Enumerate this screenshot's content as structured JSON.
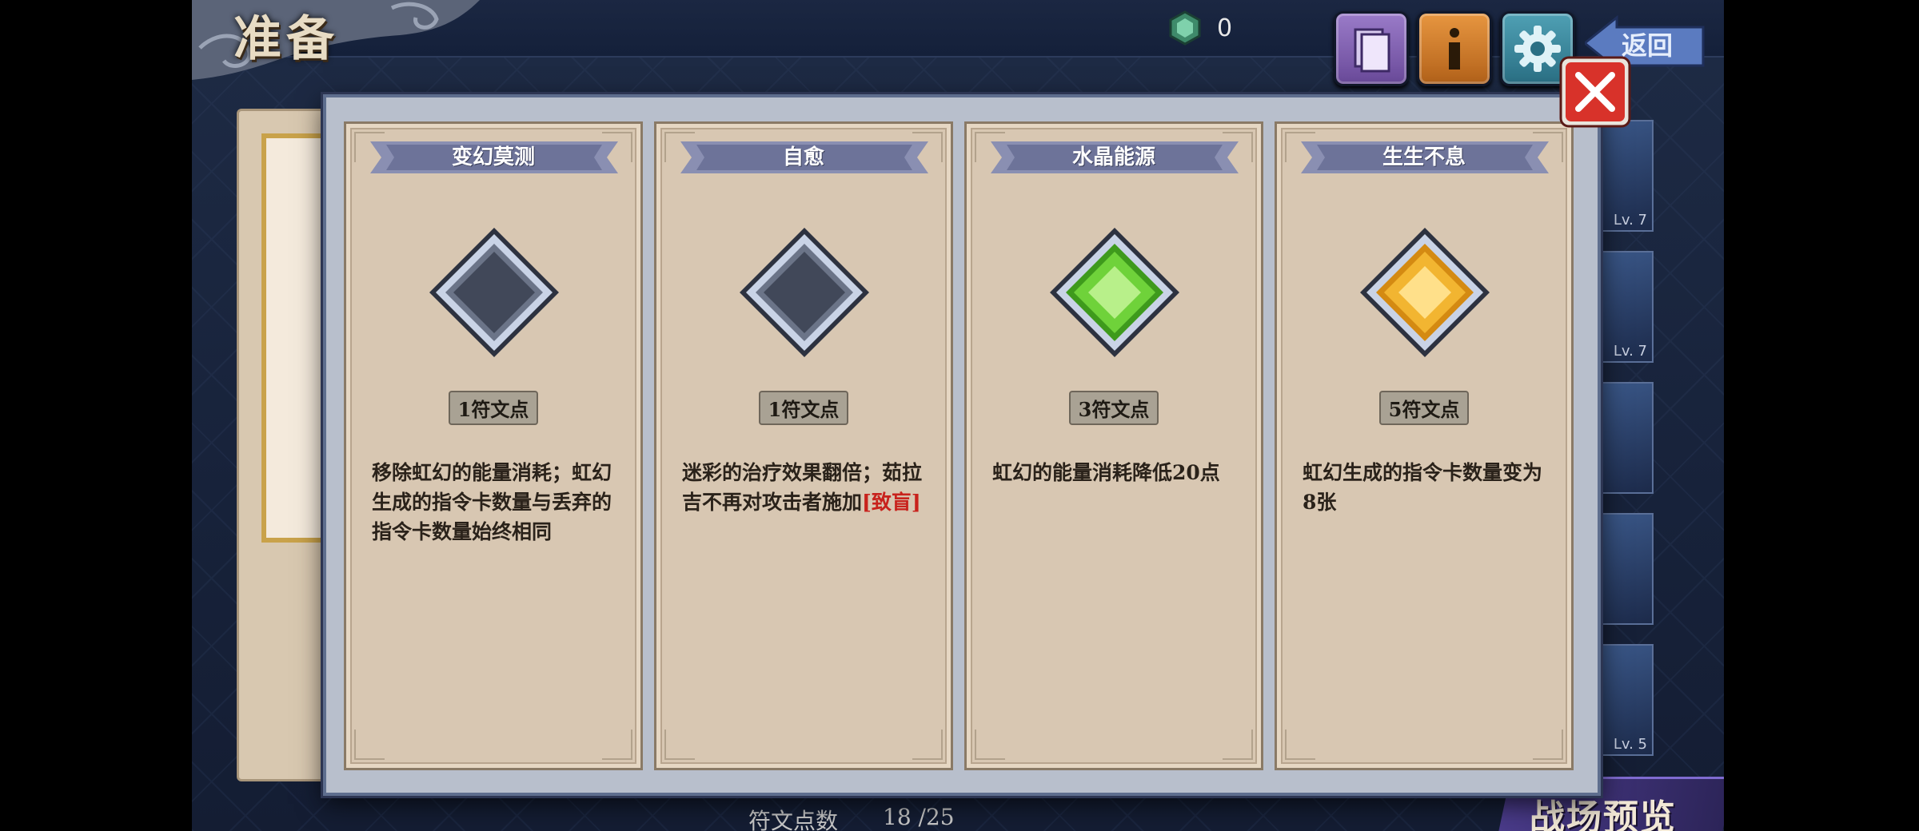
{
  "header": {
    "title": "准备",
    "currency_value": "0",
    "back_label": "返回"
  },
  "side_cards": [
    {
      "level": "Lv. 7"
    },
    {
      "level": "Lv. 7"
    },
    {
      "level": ""
    },
    {
      "level": ""
    },
    {
      "level": "Lv. 5"
    }
  ],
  "footer": {
    "rune_points_label": "符文点数",
    "rune_points_value": "18 /25",
    "battle_preview_label": "战场预览"
  },
  "modal": {
    "cards": [
      {
        "name": "变幻莫测",
        "gem": "empty",
        "cost": "1符文点",
        "desc": "移除虹幻的能量消耗；虹幻生成的指令卡数量与丢弃的指令卡数量始终相同",
        "keyword": ""
      },
      {
        "name": "自愈",
        "gem": "empty",
        "cost": "1符文点",
        "desc": "迷彩的治疗效果翻倍；茹拉吉不再对攻击者施加",
        "keyword": "[致盲]"
      },
      {
        "name": "水晶能源",
        "gem": "green",
        "cost": "3符文点",
        "desc": "虹幻的能量消耗降低20点",
        "keyword": ""
      },
      {
        "name": "生生不息",
        "gem": "gold",
        "cost": "5符文点",
        "desc": "虹幻生成的指令卡数量变为8张",
        "keyword": ""
      }
    ]
  },
  "colors": {
    "keyword_red": "#c8221c",
    "gem_green": "#6fd23a",
    "gem_gold": "#f2b531",
    "close_red": "#d8322a"
  }
}
